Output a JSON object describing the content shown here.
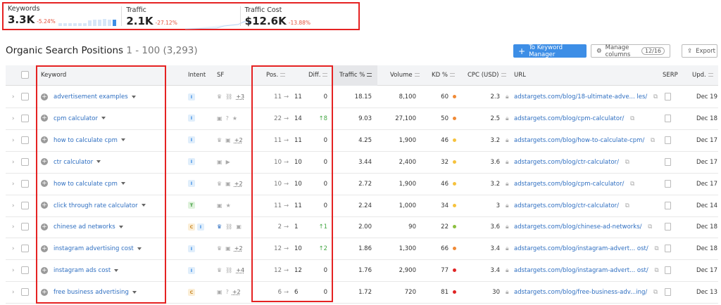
{
  "stats": [
    {
      "label": "Keywords",
      "value": "3.3K",
      "delta": "-5.24%"
    },
    {
      "label": "Traffic",
      "value": "2.1K",
      "delta": "-27.12%"
    },
    {
      "label": "Traffic Cost",
      "value": "$12.6K",
      "delta": "-13.88%"
    }
  ],
  "header": {
    "title": "Organic Search Positions",
    "range": "1 - 100 (3,293)"
  },
  "toolbar": {
    "keyword_manager": "To Keyword Manager",
    "manage_columns": "Manage columns",
    "columns_badge": "12/16",
    "export": "Export"
  },
  "columns": {
    "keyword": "Keyword",
    "intent": "Intent",
    "sf": "SF",
    "pos": "Pos.",
    "diff": "Diff.",
    "traffic": "Traffic %",
    "volume": "Volume",
    "kd": "KD %",
    "cpc": "CPC (USD)",
    "url": "URL",
    "serp": "SERP",
    "upd": "Upd."
  },
  "colors": {
    "accent": "#3d8ee6",
    "link": "#2f6fc1",
    "negative": "#e5533d",
    "positive": "#45a745",
    "kd_orange": "#f08a36",
    "kd_yellow": "#f6c23d",
    "kd_green": "#8cbf3f",
    "kd_red": "#e02424"
  },
  "rows": [
    {
      "keyword": "advertisement examples",
      "intent": [
        "I"
      ],
      "sf": [
        "crown",
        "link"
      ],
      "sf_more": "+3",
      "pos_from": "11",
      "pos_to": "11",
      "diff": "0",
      "up": false,
      "traffic": "18.15",
      "volume": "8,100",
      "kd": "60",
      "kd_color": "#f08a36",
      "cpc": "2.3",
      "url": "adstargets.com/blog/18-ultimate-adve... les/",
      "upd": "Dec 19"
    },
    {
      "keyword": "cpm calculator",
      "intent": [
        "I"
      ],
      "sf": [
        "review",
        "faq",
        "star"
      ],
      "sf_more": "",
      "pos_from": "22",
      "pos_to": "14",
      "diff": "8",
      "up": true,
      "traffic": "9.03",
      "volume": "27,100",
      "kd": "50",
      "kd_color": "#f08a36",
      "cpc": "2.5",
      "url": "adstargets.com/blog/cpm-calculator/",
      "upd": "Dec 18"
    },
    {
      "keyword": "how to calculate cpm",
      "intent": [
        "I"
      ],
      "sf": [
        "crown",
        "review"
      ],
      "sf_more": "+2",
      "pos_from": "11",
      "pos_to": "11",
      "diff": "0",
      "up": false,
      "traffic": "4.25",
      "volume": "1,900",
      "kd": "46",
      "kd_color": "#f6c23d",
      "cpc": "3.2",
      "url": "adstargets.com/blog/how-to-calculate-cpm/",
      "upd": "Dec 17"
    },
    {
      "keyword": "ctr calculator",
      "intent": [
        "I"
      ],
      "sf": [
        "review",
        "video"
      ],
      "sf_more": "",
      "pos_from": "10",
      "pos_to": "10",
      "diff": "0",
      "up": false,
      "traffic": "3.44",
      "volume": "2,400",
      "kd": "32",
      "kd_color": "#f6c23d",
      "cpc": "3.6",
      "url": "adstargets.com/blog/ctr-calculator/",
      "upd": "Dec 17"
    },
    {
      "keyword": "how to calculate cpm",
      "intent": [
        "I"
      ],
      "sf": [
        "crown",
        "review"
      ],
      "sf_more": "+2",
      "pos_from": "10",
      "pos_to": "10",
      "diff": "0",
      "up": false,
      "traffic": "2.72",
      "volume": "1,900",
      "kd": "46",
      "kd_color": "#f6c23d",
      "cpc": "3.2",
      "url": "adstargets.com/blog/cpm-calculator/",
      "upd": "Dec 17"
    },
    {
      "keyword": "click through rate calculator",
      "intent": [
        "T"
      ],
      "sf": [
        "review",
        "star"
      ],
      "sf_more": "",
      "pos_from": "11",
      "pos_to": "11",
      "diff": "0",
      "up": false,
      "traffic": "2.24",
      "volume": "1,000",
      "kd": "34",
      "kd_color": "#f6c23d",
      "cpc": "3",
      "url": "adstargets.com/blog/ctr-calculator/",
      "upd": "Dec 14"
    },
    {
      "keyword": "chinese ad networks",
      "intent": [
        "C",
        "I"
      ],
      "sf": [
        "crown-active",
        "link",
        "review"
      ],
      "sf_more": "",
      "pos_from": "2",
      "pos_to": "1",
      "diff": "1",
      "up": true,
      "traffic": "2.00",
      "volume": "90",
      "kd": "22",
      "kd_color": "#8cbf3f",
      "cpc": "3.6",
      "url": "adstargets.com/blog/chinese-ad-networks/",
      "upd": "Dec 18"
    },
    {
      "keyword": "instagram advertising cost",
      "intent": [
        "I"
      ],
      "sf": [
        "crown",
        "review"
      ],
      "sf_more": "+2",
      "pos_from": "12",
      "pos_to": "10",
      "diff": "2",
      "up": true,
      "traffic": "1.86",
      "volume": "1,300",
      "kd": "66",
      "kd_color": "#f08a36",
      "cpc": "3.4",
      "url": "adstargets.com/blog/instagram-advert... ost/",
      "upd": "Dec 18"
    },
    {
      "keyword": "instagram ads cost",
      "intent": [
        "I"
      ],
      "sf": [
        "crown",
        "link"
      ],
      "sf_more": "+4",
      "pos_from": "12",
      "pos_to": "12",
      "diff": "0",
      "up": false,
      "traffic": "1.76",
      "volume": "2,900",
      "kd": "77",
      "kd_color": "#e02424",
      "cpc": "3.4",
      "url": "adstargets.com/blog/instagram-advert... ost/",
      "upd": "Dec 17"
    },
    {
      "keyword": "free business advertising",
      "intent": [
        "C"
      ],
      "sf": [
        "review",
        "faq"
      ],
      "sf_more": "+2",
      "pos_from": "6",
      "pos_to": "6",
      "diff": "0",
      "up": false,
      "traffic": "1.72",
      "volume": "720",
      "kd": "81",
      "kd_color": "#e02424",
      "cpc": "30",
      "url": "adstargets.com/blog/free-business-adv...ing/",
      "upd": "Dec 13"
    }
  ]
}
